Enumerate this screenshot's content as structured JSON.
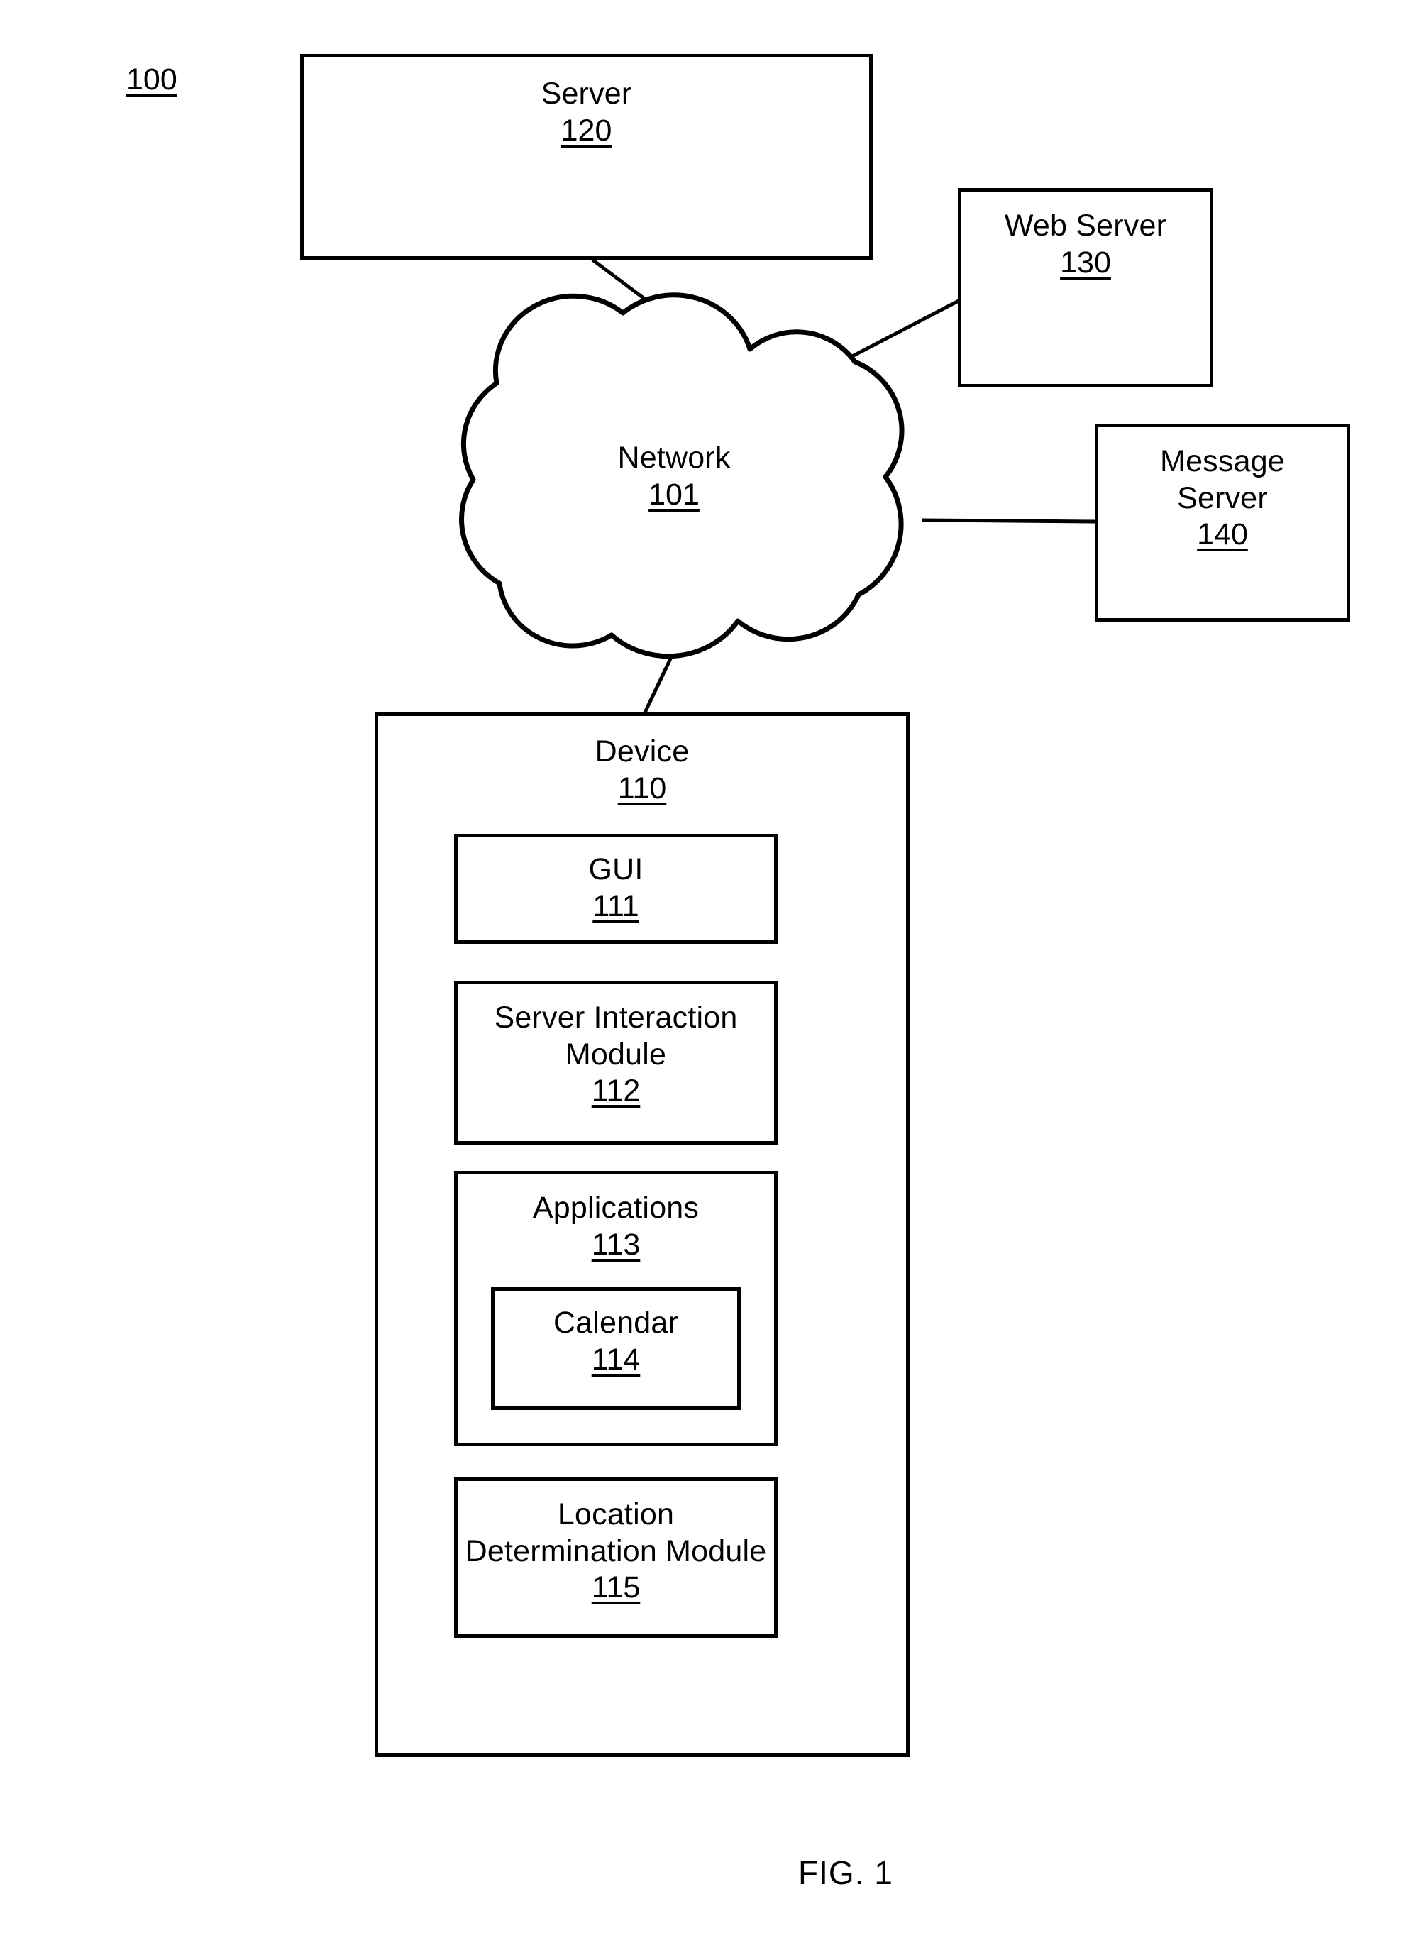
{
  "figure": {
    "system_ref": "100",
    "caption": "FIG. 1"
  },
  "nodes": {
    "server": {
      "title": "Server",
      "ref": "120"
    },
    "web_server": {
      "title": "Web Server",
      "ref": "130"
    },
    "message_server": {
      "title": "Message\nServer",
      "ref": "140"
    },
    "network": {
      "title": "Network",
      "ref": "101"
    },
    "device": {
      "title": "Device",
      "ref": "110"
    },
    "gui": {
      "title": "GUI",
      "ref": "111"
    },
    "server_interaction_module": {
      "title": "Server Interaction\nModule",
      "ref": "112"
    },
    "applications": {
      "title": "Applications",
      "ref": "113"
    },
    "calendar": {
      "title": "Calendar",
      "ref": "114"
    },
    "location_determination_module": {
      "title": "Location\nDetermination Module",
      "ref": "115"
    }
  },
  "connections": [
    {
      "from": "server",
      "to": "network"
    },
    {
      "from": "web_server",
      "to": "network"
    },
    {
      "from": "message_server",
      "to": "network"
    },
    {
      "from": "network",
      "to": "device"
    }
  ],
  "style": {
    "stroke": "#000000",
    "background": "#ffffff"
  }
}
